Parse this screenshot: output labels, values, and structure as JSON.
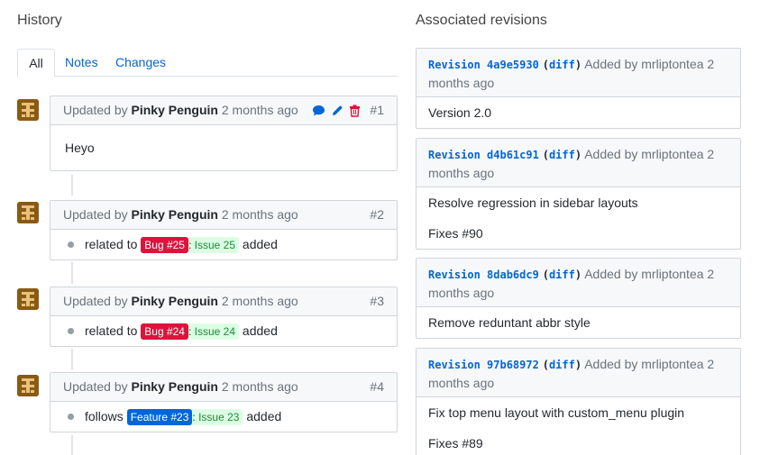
{
  "history": {
    "title": "History",
    "tabs": [
      "All",
      "Notes",
      "Changes"
    ],
    "entries": [
      {
        "prefix": "Updated by",
        "author": "Pinky Penguin",
        "time": "2 months ago",
        "number": "#1",
        "kind": "note",
        "text": "Heyo"
      },
      {
        "prefix": "Updated by",
        "author": "Pinky Penguin",
        "time": "2 months ago",
        "number": "#2",
        "kind": "change",
        "relation": "related to",
        "badge": "Bug #25",
        "badge_type": "bug",
        "issue": "Issue 25",
        "suffix": "added"
      },
      {
        "prefix": "Updated by",
        "author": "Pinky Penguin",
        "time": "2 months ago",
        "number": "#3",
        "kind": "change",
        "relation": "related to",
        "badge": "Bug #24",
        "badge_type": "bug",
        "issue": "Issue 24",
        "suffix": "added"
      },
      {
        "prefix": "Updated by",
        "author": "Pinky Penguin",
        "time": "2 months ago",
        "number": "#4",
        "kind": "change",
        "relation": "follows",
        "badge": "Feature #23",
        "badge_type": "feature",
        "issue": "Issue 23",
        "suffix": "added"
      }
    ]
  },
  "revisions": {
    "title": "Associated revisions",
    "items": [
      {
        "label": "Revision 4a9e5930",
        "diff": "diff",
        "added": "Added by mrliptontea 2 months ago",
        "lines": [
          "Version 2.0"
        ]
      },
      {
        "label": "Revision d4b61c91",
        "diff": "diff",
        "added": "Added by mrliptontea 2 months ago",
        "lines": [
          "Resolve regression in sidebar layouts",
          "Fixes #90"
        ]
      },
      {
        "label": "Revision 8dab6dc9",
        "diff": "diff",
        "added": "Added by mrliptontea 2 months ago",
        "lines": [
          "Remove reduntant abbr style"
        ]
      },
      {
        "label": "Revision 97b68972",
        "diff": "diff",
        "added": "Added by mrliptontea 2 months ago",
        "lines": [
          "Fix top menu layout with custom_menu plugin",
          "Fixes #89"
        ]
      }
    ]
  },
  "colors": {
    "link": "#0366d6",
    "bug": "#dc143c",
    "feature": "#0366d6",
    "issue_bg": "#dcffe4"
  },
  "icons": {
    "comment": "comment-icon",
    "edit": "pencil-icon",
    "delete": "trash-icon"
  }
}
